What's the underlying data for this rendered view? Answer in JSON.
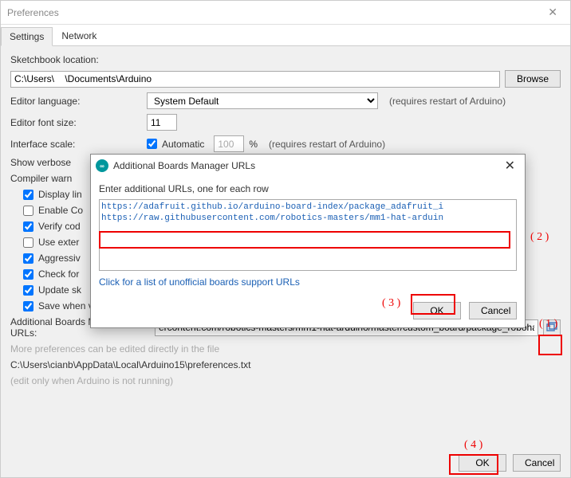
{
  "window": {
    "title": "Preferences",
    "tabs": {
      "settings": "Settings",
      "network": "Network"
    }
  },
  "sketchbook": {
    "label": "Sketchbook location:",
    "value": "C:\\Users\\    \\Documents\\Arduino",
    "browse": "Browse"
  },
  "editorLanguage": {
    "label": "Editor language:",
    "value": "System Default",
    "hint": "(requires restart of Arduino)"
  },
  "fontSize": {
    "label": "Editor font size:",
    "value": "11"
  },
  "interfaceScale": {
    "label": "Interface scale:",
    "auto": "Automatic",
    "value": "100",
    "unit": "%",
    "hint": "(requires restart of Arduino)"
  },
  "verbose": {
    "label": "Show verbose"
  },
  "compilerWarn": {
    "label": "Compiler warn"
  },
  "checkboxes": {
    "displayLine": "Display lin",
    "enableCo": "Enable Co",
    "verifyCode": "Verify cod",
    "useExtern": "Use exter",
    "aggressive": "Aggressiv",
    "checkFor": "Check for",
    "updateSk": "Update sk",
    "saveWhen": "Save when verifying or uploading"
  },
  "additionalUrls": {
    "label": "Additional Boards Manager URLs:",
    "value": "ercontent.com/robotics-masters/mm1-hat-arduino/master/custom_board/package_robohat_index.json"
  },
  "morePrefs": "More preferences can be edited directly in the file",
  "prefsPath": "C:\\Users\\cianb\\AppData\\Local\\Arduino15\\preferences.txt",
  "editOnly": "(edit only when Arduino is not running)",
  "buttons": {
    "ok": "OK",
    "cancel": "Cancel"
  },
  "modal": {
    "title": "Additional Boards Manager URLs",
    "instruction": "Enter additional URLs, one for each row",
    "textarea": "https://adafruit.github.io/arduino-board-index/package_adafruit_i\nhttps://raw.githubusercontent.com/robotics-masters/mm1-hat-arduin\n",
    "link": "Click for a list of unofficial boards support URLs",
    "ok": "OK",
    "cancel": "Cancel"
  },
  "annotations": {
    "a1": "( 1 )",
    "a2": "( 2 )",
    "a3": "( 3 )",
    "a4": "( 4 )"
  }
}
